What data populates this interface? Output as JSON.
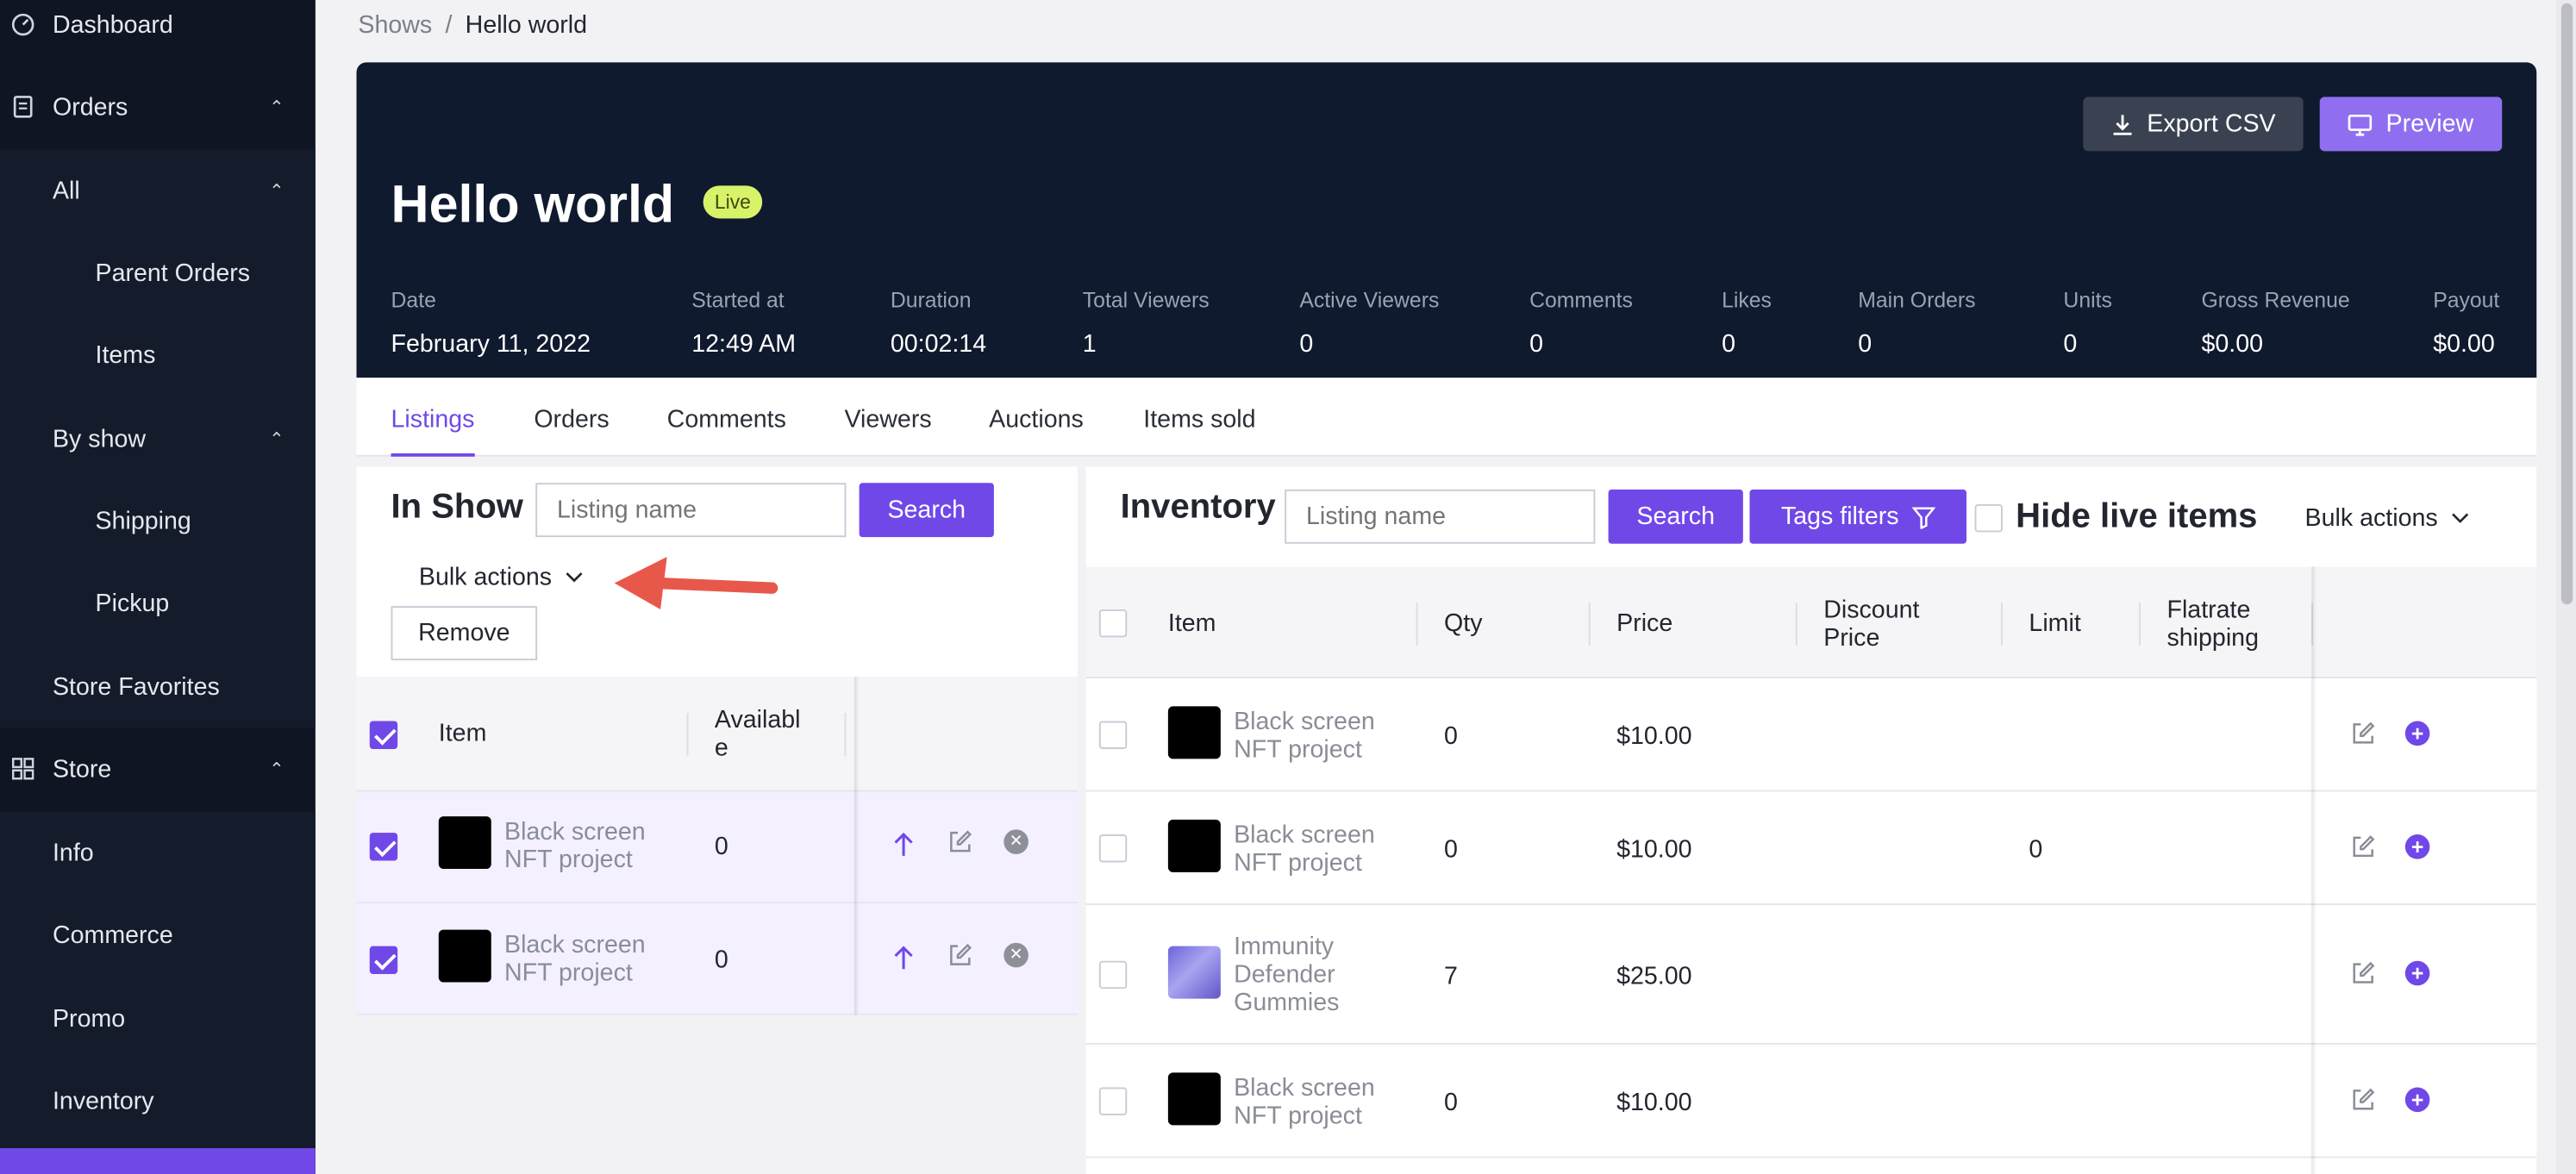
{
  "sidebar": {
    "dashboard": "Dashboard",
    "orders": "Orders",
    "all": "All",
    "parent_orders": "Parent Orders",
    "items": "Items",
    "by_show": "By show",
    "shipping": "Shipping",
    "pickup": "Pickup",
    "store_favorites": "Store Favorites",
    "store": "Store",
    "info": "Info",
    "commerce": "Commerce",
    "promo": "Promo",
    "inventory": "Inventory"
  },
  "breadcrumb": {
    "root": "Shows",
    "sep": "/",
    "current": "Hello world"
  },
  "show": {
    "title": "Hello world",
    "badge": "Live",
    "export_label": "Export CSV",
    "preview_label": "Preview",
    "stats": [
      {
        "label": "Date",
        "value": "February 11, 2022"
      },
      {
        "label": "Started at",
        "value": "12:49 AM"
      },
      {
        "label": "Duration",
        "value": "00:02:14"
      },
      {
        "label": "Total Viewers",
        "value": "1"
      },
      {
        "label": "Active Viewers",
        "value": "0"
      },
      {
        "label": "Comments",
        "value": "0"
      },
      {
        "label": "Likes",
        "value": "0"
      },
      {
        "label": "Main Orders",
        "value": "0"
      },
      {
        "label": "Units",
        "value": "0"
      },
      {
        "label": "Gross Revenue",
        "value": "$0.00"
      },
      {
        "label": "Payout",
        "value": "$0.00"
      }
    ]
  },
  "tabs": [
    "Listings",
    "Orders",
    "Comments",
    "Viewers",
    "Auctions",
    "Items sold"
  ],
  "in_show": {
    "title": "In Show",
    "search_placeholder": "Listing name",
    "search_label": "Search",
    "bulk_label": "Bulk actions",
    "remove_label": "Remove",
    "columns": {
      "item": "Item",
      "available": "Availabl\ne"
    },
    "rows": [
      {
        "name": "Black screen\nNFT project",
        "available": "0"
      },
      {
        "name": "Black screen\nNFT project",
        "available": "0"
      }
    ]
  },
  "inventory": {
    "title": "Inventory",
    "search_placeholder": "Listing name",
    "search_label": "Search",
    "tags_label": "Tags filters",
    "hide_live_label": "Hide live items",
    "bulk_label": "Bulk actions",
    "columns": {
      "item": "Item",
      "qty": "Qty",
      "price": "Price",
      "discount": "Discount\nPrice",
      "limit": "Limit",
      "flatrate": "Flatrate\nshipping"
    },
    "rows": [
      {
        "name": "Black screen\nNFT project",
        "qty": "0",
        "price": "$10.00",
        "limit": ""
      },
      {
        "name": "Black screen\nNFT project",
        "qty": "0",
        "price": "$10.00",
        "limit": "0"
      },
      {
        "name": "Immunity\nDefender\nGummies",
        "qty": "7",
        "price": "$25.00",
        "limit": ""
      },
      {
        "name": "Black screen\nNFT project",
        "qty": "0",
        "price": "$10.00",
        "limit": ""
      }
    ]
  },
  "colors": {
    "accent": "#7048e8",
    "hero_bg": "#0f1a2e",
    "live_badge": "#d8f26a",
    "annotation_arrow": "#e8584a"
  }
}
